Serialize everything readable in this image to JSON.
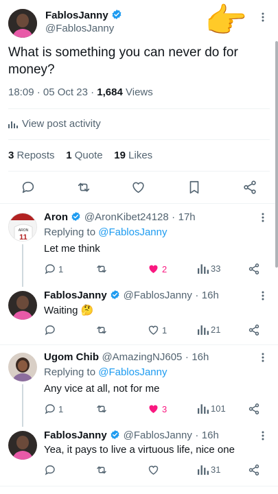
{
  "main_post": {
    "author_name": "FablosJanny",
    "author_handle": "@FablosJanny",
    "text": "What is something you can never do for money?",
    "time": "18:09",
    "date": "05 Oct 23",
    "views_count": "1,684",
    "views_label": "Views",
    "activity_label": "View post activity",
    "reposts_count": "3",
    "reposts_label": "Reposts",
    "quotes_count": "1",
    "quotes_label": "Quote",
    "likes_count": "19",
    "likes_label": "Likes",
    "overlay_emoji": "👉"
  },
  "replies": [
    {
      "name": "Aron",
      "handle": "@AronKibet24128",
      "time": "17h",
      "replying_to_label": "Replying to",
      "replying_to_handle": "@FablosJanny",
      "text": "Let me think",
      "replies": "1",
      "likes": "2",
      "liked": true,
      "views": "33",
      "avatar_text": "ARON",
      "avatar_number": "11"
    },
    {
      "name": "FablosJanny",
      "handle": "@FablosJanny",
      "time": "16h",
      "text": "Waiting",
      "emoji": "🤔",
      "likes": "1",
      "liked": false,
      "views": "21"
    },
    {
      "name": "Ugom Chib",
      "handle": "@AmazingNJ605",
      "time": "16h",
      "replying_to_label": "Replying to",
      "replying_to_handle": "@FablosJanny",
      "text": "Any vice at all, not for me",
      "replies": "1",
      "likes": "3",
      "liked": true,
      "views": "101"
    },
    {
      "name": "FablosJanny",
      "handle": "@FablosJanny",
      "time": "16h",
      "text": "Yea, it pays to live a virtuous life, nice one",
      "views": "31"
    }
  ],
  "colors": {
    "accent": "#1d9bf0",
    "like": "#f91880",
    "muted": "#536471",
    "divider": "#eff3f4"
  },
  "icons": [
    "verified-badge-icon",
    "more-options-icon",
    "reply-icon",
    "repost-icon",
    "like-icon",
    "bookmark-icon",
    "share-icon",
    "views-icon",
    "analytics-icon",
    "pointing-hand-emoji"
  ]
}
